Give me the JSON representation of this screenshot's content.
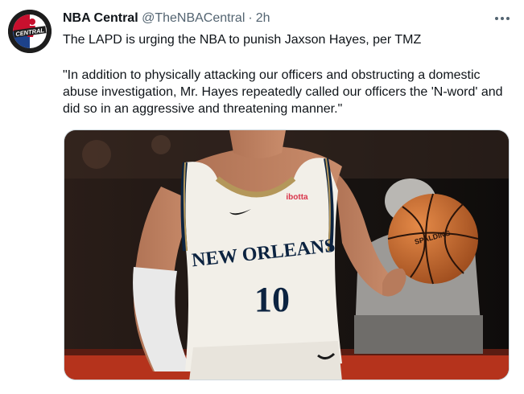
{
  "author": {
    "name": "NBA Central",
    "handle": "@TheNBACentral",
    "separator": "·",
    "time": "2h",
    "avatar_text": "CENTRAL"
  },
  "tweet": {
    "line1": "The LAPD is urging the NBA to punish Jaxson Hayes, per TMZ",
    "quote": "\"In addition to physically attacking our officers and obstructing a domestic abuse investigation, Mr. Hayes repeatedly called our officers the 'N-word' and did so in an aggressive and threatening manner.\""
  },
  "media": {
    "jersey_team": "NEW ORLEANS",
    "jersey_number": "10",
    "sponsor": "ibotta",
    "ball_brand": "SPALDING"
  },
  "icons": {
    "more": "more-horizontal-icon"
  }
}
